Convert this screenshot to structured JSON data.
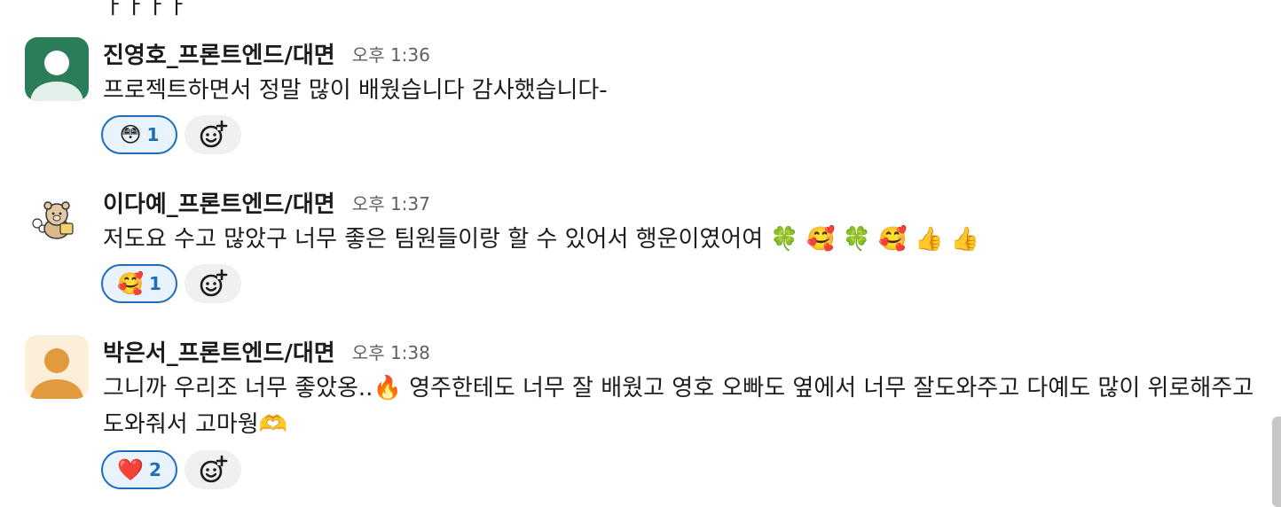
{
  "prev_fragment": "ㅏㅏㅏㅏ",
  "messages": [
    {
      "username": "진영호_프론트엔드/대면",
      "time": "오후 1:36",
      "text": "프로젝트하면서 정말 많이 배웠습니다 감사했습니다-",
      "emojis": "",
      "avatar": {
        "type": "default-person",
        "bg": "#2a7d57"
      },
      "reaction": {
        "emoji": "😳",
        "count": "1"
      }
    },
    {
      "username": "이다예_프론트엔드/대면",
      "time": "오후 1:37",
      "text": "저도요 수고 많았구 너무 좋은 팀원들이랑 할 수 있어서 행운이였어여 ",
      "emojis": "🍀 🥰 🍀 🥰 👍 👍",
      "avatar": {
        "type": "bear-illustration",
        "bg": "#ffffff"
      },
      "reaction": {
        "emoji": "🥰",
        "count": "1"
      }
    },
    {
      "username": "박은서_프론트엔드/대면",
      "time": "오후 1:38",
      "text_part1": "그니까 우리조 너무 좋았옹..",
      "emoji_mid": "🔥",
      "text_part2": " 영주한테도 너무 잘 배웠고 영호 오빠도 옆에서 너무 잘도와주고 다예도 많이 위로해주고 도와줘서 고마웡",
      "emoji_end": "🫶",
      "avatar": {
        "type": "default-person",
        "bg": "#fcefd9"
      },
      "reaction": {
        "emoji": "❤️",
        "count": "2"
      }
    }
  ],
  "colors": {
    "reaction_border": "#1d6dbb",
    "reaction_bg": "#e8f3fd",
    "timestamp": "#616061"
  }
}
